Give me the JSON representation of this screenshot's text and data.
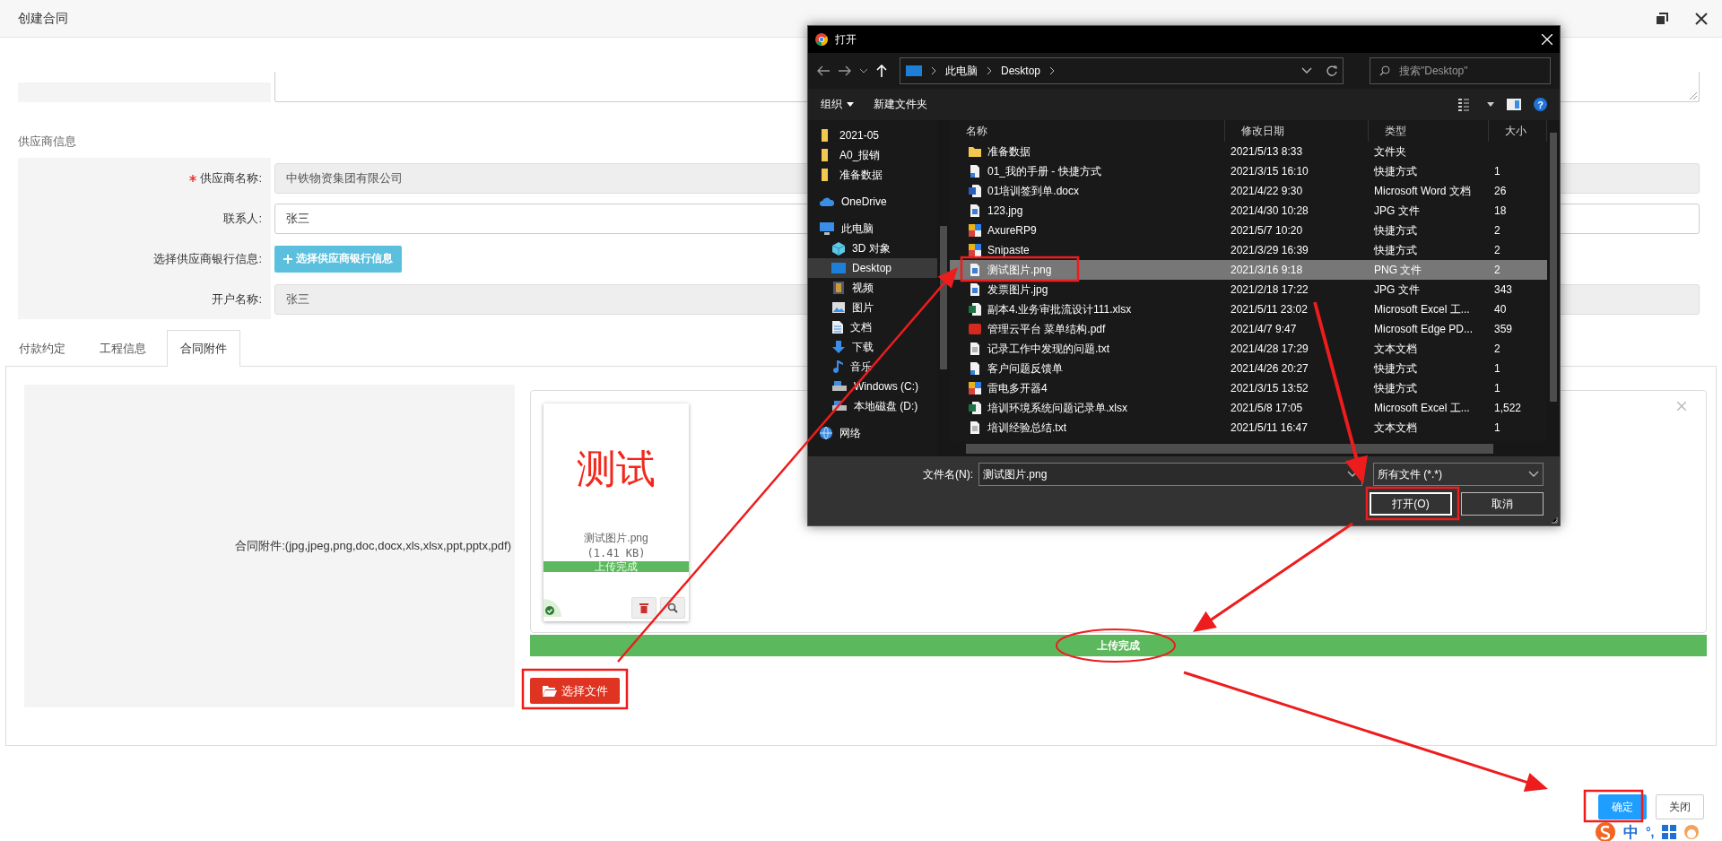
{
  "window": {
    "title": "创建合同"
  },
  "form": {
    "section": "供应商信息",
    "fields": [
      {
        "kind": "input",
        "label": "供应商名称:",
        "required": true,
        "value": "中铁物资集团有限公司",
        "disabled": true
      },
      {
        "kind": "input",
        "label": "联系人:",
        "required": false,
        "value": "张三",
        "disabled": false
      },
      {
        "kind": "button",
        "label": "选择供应商银行信息:",
        "required": false,
        "button": "选择供应商银行信息"
      },
      {
        "kind": "input",
        "label": "开户名称:",
        "required": false,
        "value": "张三",
        "disabled": true
      }
    ]
  },
  "tabs": [
    {
      "label": "付款约定",
      "selected": false
    },
    {
      "label": "工程信息",
      "selected": false
    },
    {
      "label": "合同附件",
      "selected": true
    }
  ],
  "attachment": {
    "label": "合同附件:(jpg,jpeg,png,doc,docx,xls,xlsx,ppt,pptx,pdf)",
    "file": {
      "preview_text": "测试",
      "name": "测试图片.png",
      "size": "(1.41 KB)",
      "status": "上传完成"
    },
    "progress": {
      "level": 1,
      "text": "上传完成"
    },
    "choose_button": "选择文件"
  },
  "footer_buttons": [
    {
      "label": "确定",
      "primary": true
    },
    {
      "label": "关闭",
      "primary": false
    }
  ],
  "file_dialog": {
    "title": "打开",
    "breadcrumb": [
      "此电脑",
      "Desktop"
    ],
    "search_placeholder": "搜索\"Desktop\"",
    "toolbar": [
      "组织",
      "新建文件夹"
    ],
    "help": "?",
    "nav": [
      {
        "label": "2021-05",
        "kind": "folder",
        "selected": false
      },
      {
        "label": "A0_报销",
        "kind": "folder",
        "selected": false
      },
      {
        "label": "准备数据",
        "kind": "folder",
        "selected": false
      },
      {
        "label": "OneDrive",
        "kind": "cloud",
        "selected": false
      },
      {
        "label": "此电脑",
        "kind": "computer",
        "selected": false,
        "children": [
          {
            "label": "3D 对象",
            "kind": "cube",
            "selected": false
          },
          {
            "label": "Desktop",
            "kind": "desktop",
            "selected": true
          },
          {
            "label": "视频",
            "kind": "video",
            "selected": false
          },
          {
            "label": "图片",
            "kind": "pictures",
            "selected": false
          },
          {
            "label": "文档",
            "kind": "documents",
            "selected": false
          },
          {
            "label": "下载",
            "kind": "downloads",
            "selected": false
          },
          {
            "label": "音乐",
            "kind": "music",
            "selected": false
          },
          {
            "label": "Windows (C:)",
            "kind": "drive",
            "selected": false
          },
          {
            "label": "本地磁盘 (D:)",
            "kind": "drive",
            "selected": false
          }
        ]
      },
      {
        "label": "网络",
        "kind": "network",
        "selected": false
      }
    ],
    "columns": [
      "名称",
      "修改日期",
      "类型",
      "大小"
    ],
    "files": [
      {
        "name": "准备数据",
        "date": "2021/5/13 8:33",
        "type": "文件夹",
        "kind": "folder",
        "selected": false
      },
      {
        "name": "01_我的手册 - 快捷方式",
        "date": "2021/3/15 16:10",
        "type": "快捷方式",
        "size": "1",
        "kind": "shortcut",
        "selected": false
      },
      {
        "name": "01培训签到单.docx",
        "date": "2021/4/22 9:30",
        "type": "Microsoft Word 文档",
        "size": "26",
        "kind": "word",
        "selected": false
      },
      {
        "name": "123.jpg",
        "date": "2021/4/30 10:28",
        "type": "JPG 文件",
        "size": "18",
        "kind": "image",
        "selected": false
      },
      {
        "name": "AxureRP9",
        "date": "2021/5/7 10:20",
        "type": "快捷方式",
        "size": "2",
        "kind": "app",
        "selected": false
      },
      {
        "name": "Snipaste",
        "date": "2021/3/29 16:39",
        "type": "快捷方式",
        "size": "2",
        "kind": "app",
        "selected": false
      },
      {
        "name": "测试图片.png",
        "date": "2021/3/16 9:18",
        "type": "PNG 文件",
        "size": "2",
        "kind": "image",
        "selected": true
      },
      {
        "name": "发票图片.jpg",
        "date": "2021/2/18 17:22",
        "type": "JPG 文件",
        "size": "343",
        "kind": "image",
        "selected": false
      },
      {
        "name": "副本4.业务审批流设计111.xlsx",
        "date": "2021/5/11 23:02",
        "type": "Microsoft Excel 工...",
        "size": "40",
        "kind": "excel",
        "selected": false
      },
      {
        "name": "管理云平台 菜单结构.pdf",
        "date": "2021/4/7 9:47",
        "type": "Microsoft Edge PD...",
        "size": "359",
        "kind": "pdf",
        "selected": false
      },
      {
        "name": "记录工作中发现的问题.txt",
        "date": "2021/4/28 17:29",
        "type": "文本文档",
        "size": "2",
        "kind": "text",
        "selected": false
      },
      {
        "name": "客户问题反馈单",
        "date": "2021/4/26 20:27",
        "type": "快捷方式",
        "size": "1",
        "kind": "shortcut",
        "selected": false
      },
      {
        "name": "雷电多开器4",
        "date": "2021/3/15 13:52",
        "type": "快捷方式",
        "size": "1",
        "kind": "app",
        "selected": false
      },
      {
        "name": "培训环境系统问题记录单.xlsx",
        "date": "2021/5/8 17:05",
        "type": "Microsoft Excel 工...",
        "size": "1,522",
        "kind": "excel",
        "selected": false
      },
      {
        "name": "培训经验总结.txt",
        "date": "2021/5/11 16:47",
        "type": "文本文档",
        "size": "1",
        "kind": "text",
        "selected": false
      }
    ],
    "filename_label": "文件名(N):",
    "filename": "测试图片.png",
    "filter": "所有文件 (*.*)",
    "buttons": [
      "打开(O)",
      "取消"
    ]
  },
  "ime": {
    "mode": "中",
    "punctuation": "°,"
  }
}
